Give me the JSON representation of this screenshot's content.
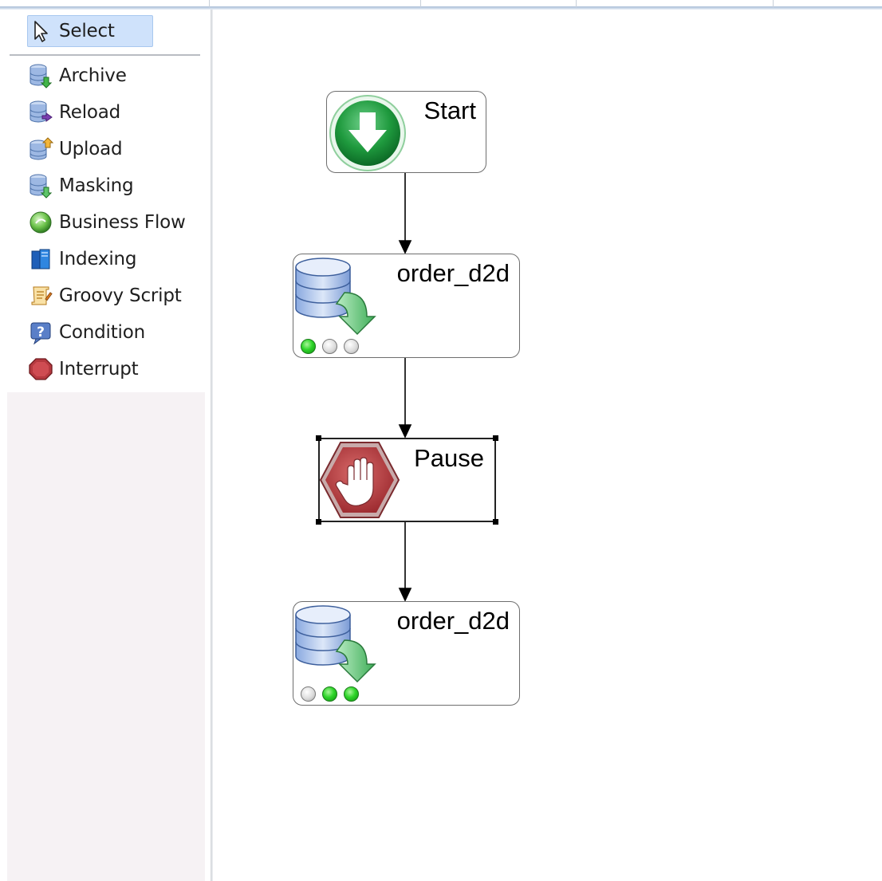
{
  "palette": {
    "select_label": "Select",
    "items": [
      {
        "label": "Archive",
        "icon": "archive-db-icon"
      },
      {
        "label": "Reload",
        "icon": "reload-db-icon"
      },
      {
        "label": "Upload",
        "icon": "upload-db-icon"
      },
      {
        "label": "Masking",
        "icon": "masking-db-icon"
      },
      {
        "label": "Business Flow",
        "icon": "business-flow-icon"
      },
      {
        "label": "Indexing",
        "icon": "indexing-icon"
      },
      {
        "label": "Groovy Script",
        "icon": "groovy-script-icon"
      },
      {
        "label": "Condition",
        "icon": "condition-icon"
      },
      {
        "label": "Interrupt",
        "icon": "interrupt-icon"
      }
    ]
  },
  "flow": {
    "start_label": "Start",
    "step1": {
      "label": "order_d2d",
      "status": [
        "on",
        "off",
        "off"
      ]
    },
    "pause_label": "Pause",
    "step2": {
      "label": "order_d2d",
      "status": [
        "off",
        "on",
        "on"
      ]
    }
  },
  "colors": {
    "select_highlight": "#cfe2fb",
    "start_green": "#1f9a3e",
    "interrupt_red": "#b53a3a",
    "status_on": "#2fd52a"
  }
}
